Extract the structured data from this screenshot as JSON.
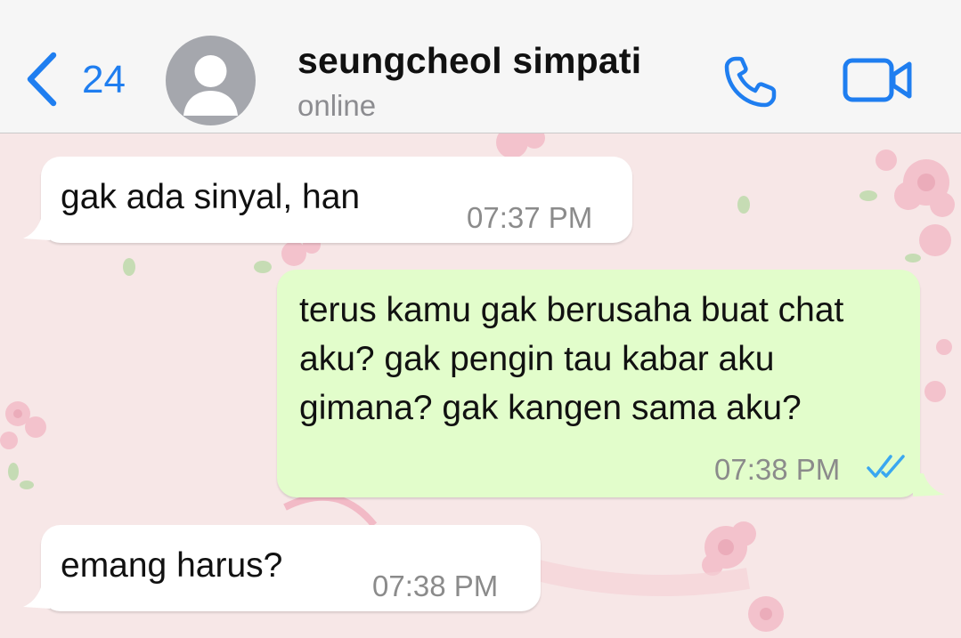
{
  "header": {
    "back_count": "24",
    "contact_name": "seungcheol simpati",
    "contact_status": "online"
  },
  "icons": {
    "back": "chevron-left-icon",
    "avatar": "person-silhouette-icon",
    "call": "phone-icon",
    "video": "video-camera-icon",
    "read_receipt": "double-check-icon"
  },
  "colors": {
    "accent": "#1f7ef0",
    "incoming_bubble": "#ffffff",
    "outgoing_bubble": "#e2fdcb",
    "read_receipt": "#3aa7f0",
    "wallpaper": "#f7e7e7"
  },
  "messages": [
    {
      "direction": "incoming",
      "text": "gak ada sinyal, han",
      "time": "07:37 PM"
    },
    {
      "direction": "outgoing",
      "text": "terus kamu gak berusaha buat chat aku? gak pengin tau kabar aku gimana? gak kangen sama aku?",
      "time": "07:38 PM",
      "status": "read"
    },
    {
      "direction": "incoming",
      "text": "emang harus?",
      "time": "07:38 PM"
    }
  ]
}
